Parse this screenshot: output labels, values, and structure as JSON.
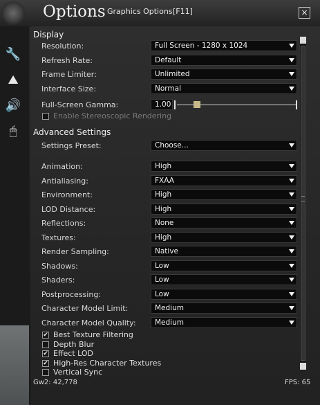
{
  "window": {
    "title": "Options",
    "subtitle": "Graphics Options",
    "hotkey": "[F11]",
    "close_icon": "×"
  },
  "sidebar": {
    "tabs": [
      {
        "icon": "wrench-icon",
        "glyph": "🔧"
      },
      {
        "icon": "mountains-icon",
        "glyph": "⛰"
      },
      {
        "icon": "speaker-icon",
        "glyph": "🔊"
      },
      {
        "icon": "mouse-icon",
        "glyph": "🖱"
      }
    ]
  },
  "display": {
    "heading": "Display",
    "rows": [
      {
        "label": "Resolution:",
        "value": "Full Screen - 1280 x 1024"
      },
      {
        "label": "Refresh Rate:",
        "value": "Default"
      },
      {
        "label": "Frame Limiter:",
        "value": "Unlimited"
      },
      {
        "label": "Interface Size:",
        "value": "Normal"
      }
    ],
    "gamma": {
      "label": "Full-Screen Gamma:",
      "value": "1.00",
      "slider_fraction": 0.17
    },
    "stereo": {
      "label": "Enable Stereoscopic Rendering",
      "checked": false,
      "disabled": true
    }
  },
  "advanced": {
    "heading": "Advanced Settings",
    "preset": {
      "label": "Settings Preset:",
      "value": "Choose..."
    },
    "rows": [
      {
        "label": "Animation:",
        "value": "High"
      },
      {
        "label": "Antialiasing:",
        "value": "FXAA"
      },
      {
        "label": "Environment:",
        "value": "High"
      },
      {
        "label": "LOD Distance:",
        "value": "High"
      },
      {
        "label": "Reflections:",
        "value": "None"
      },
      {
        "label": "Textures:",
        "value": "High"
      },
      {
        "label": "Render Sampling:",
        "value": "Native"
      },
      {
        "label": "Shadows:",
        "value": "Low"
      },
      {
        "label": "Shaders:",
        "value": "Low"
      },
      {
        "label": "Postprocessing:",
        "value": "Low"
      },
      {
        "label": "Character Model Limit:",
        "value": "Medium"
      },
      {
        "label": "Character Model Quality:",
        "value": "Medium"
      }
    ],
    "checkboxes": [
      {
        "label": "Best Texture Filtering",
        "checked": true
      },
      {
        "label": "Depth Blur",
        "checked": false
      },
      {
        "label": "Effect LOD",
        "checked": true
      },
      {
        "label": "High-Res Character Textures",
        "checked": true
      },
      {
        "label": "Vertical Sync",
        "checked": false
      }
    ]
  },
  "footer": {
    "build": "Gw2: 42,778",
    "fps": "FPS: 65"
  }
}
